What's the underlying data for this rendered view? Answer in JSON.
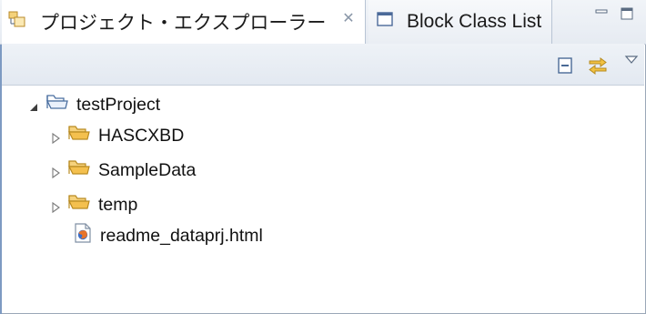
{
  "tabs": [
    {
      "label": "プロジェクト・エクスプローラー",
      "active": true,
      "icon": "project-explorer-icon"
    },
    {
      "label": "Block Class List",
      "active": false,
      "icon": "view-window-icon"
    }
  ],
  "tab_close_glyph": "✕",
  "tree": {
    "root": {
      "label": "testProject",
      "expanded": true,
      "icon": "open-folder-icon"
    },
    "children": [
      {
        "label": "HASCXBD",
        "type": "folder",
        "expanded": false
      },
      {
        "label": "SampleData",
        "type": "folder",
        "expanded": false
      },
      {
        "label": "temp",
        "type": "folder",
        "expanded": false
      },
      {
        "label": "readme_dataprj.html",
        "type": "html-file"
      }
    ]
  },
  "colors": {
    "accent_border": "#7d9ac2",
    "folder": "#e8b64a",
    "selection_bg": "#ffffff"
  }
}
